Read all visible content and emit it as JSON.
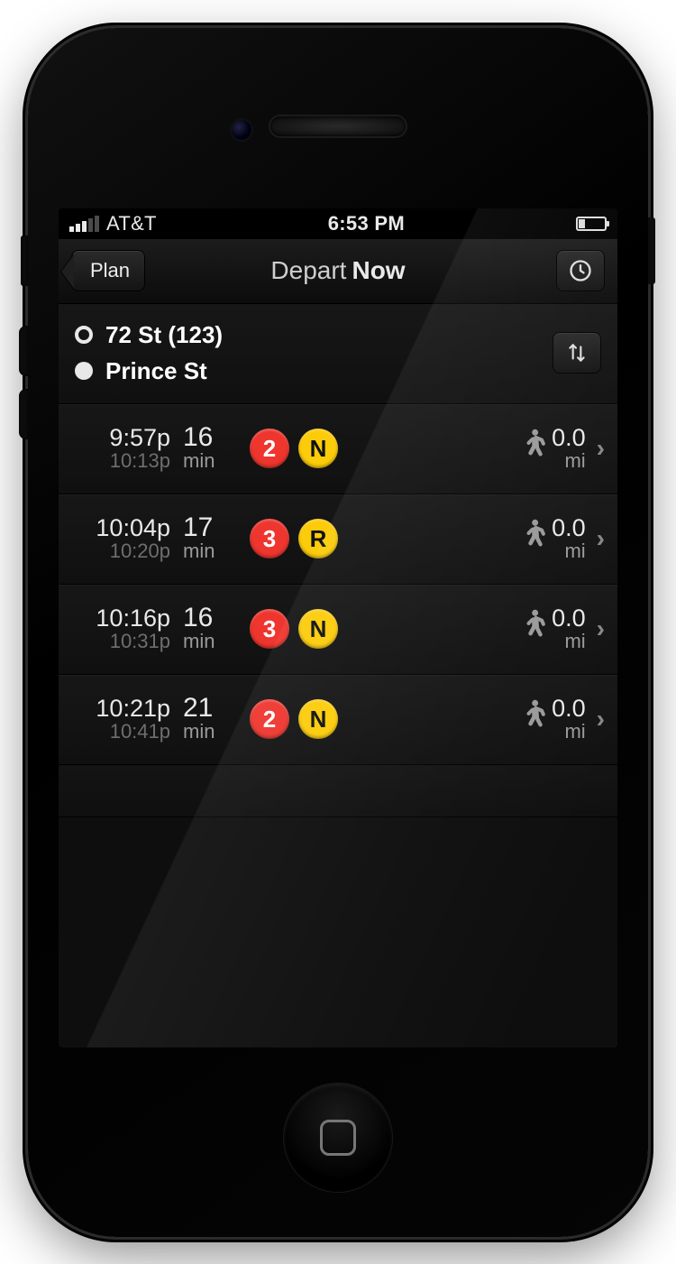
{
  "status_bar": {
    "carrier": "AT&T",
    "time": "6:53 PM",
    "battery_icon": "battery-low-icon"
  },
  "navbar": {
    "back_label": "Plan",
    "title_prefix": "Depart",
    "title_bold": "Now",
    "right_icon": "clock-icon"
  },
  "od_panel": {
    "origin": "72 St (123)",
    "destination": "Prince St",
    "swap_icon": "swap-vertical-icon"
  },
  "line_colors": {
    "2": "#ee352e",
    "3": "#ee352e",
    "N": "#fccc0a",
    "R": "#fccc0a"
  },
  "routes": [
    {
      "depart": "9:57p",
      "arrive": "10:13p",
      "duration_value": "16",
      "duration_unit": "min",
      "lines": [
        "2",
        "N"
      ],
      "walk_distance": "0.0",
      "walk_unit": "mi"
    },
    {
      "depart": "10:04p",
      "arrive": "10:20p",
      "duration_value": "17",
      "duration_unit": "min",
      "lines": [
        "3",
        "R"
      ],
      "walk_distance": "0.0",
      "walk_unit": "mi"
    },
    {
      "depart": "10:16p",
      "arrive": "10:31p",
      "duration_value": "16",
      "duration_unit": "min",
      "lines": [
        "3",
        "N"
      ],
      "walk_distance": "0.0",
      "walk_unit": "mi"
    },
    {
      "depart": "10:21p",
      "arrive": "10:41p",
      "duration_value": "21",
      "duration_unit": "min",
      "lines": [
        "2",
        "N"
      ],
      "walk_distance": "0.0",
      "walk_unit": "mi"
    }
  ]
}
